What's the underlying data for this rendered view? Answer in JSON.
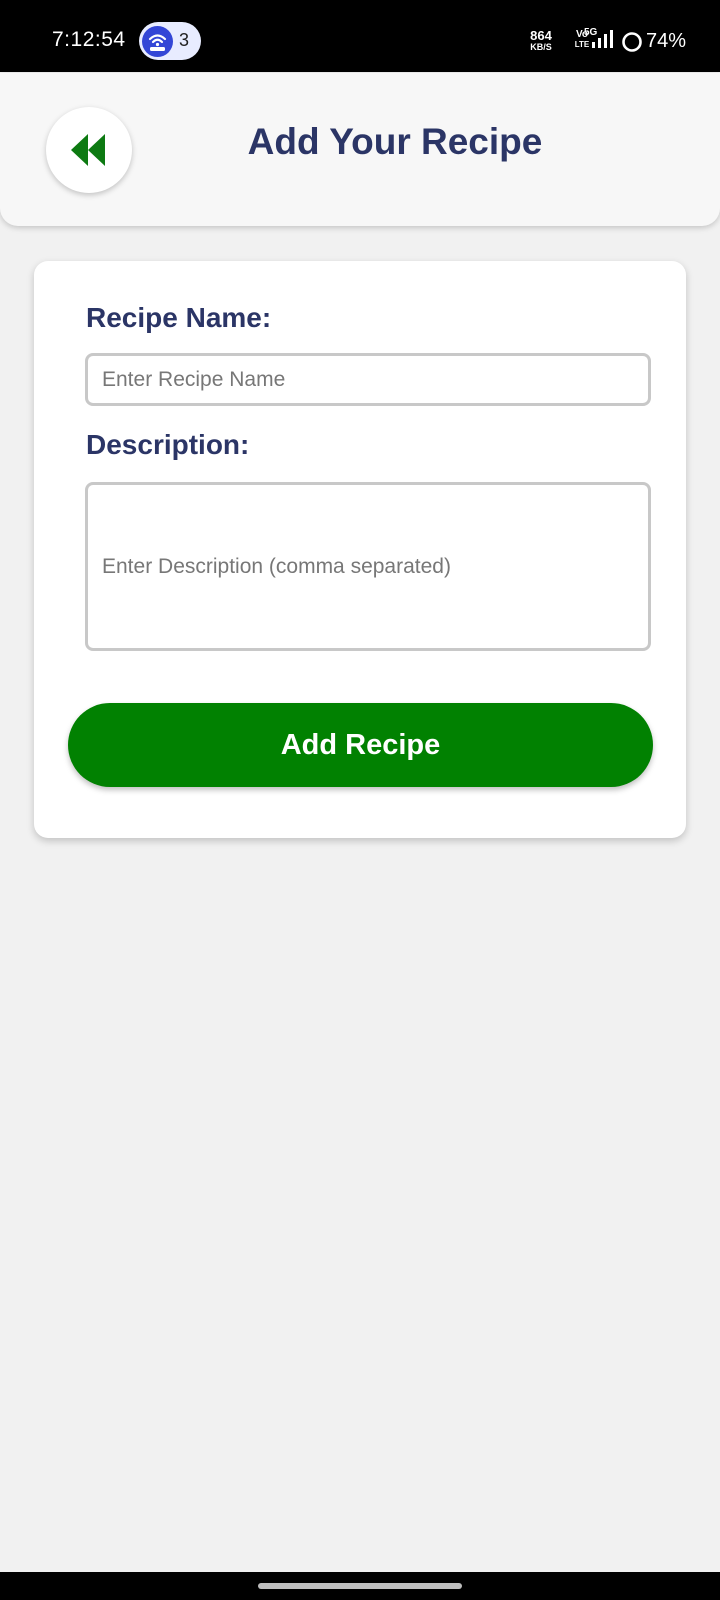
{
  "status_bar": {
    "time": "7:12:54",
    "hotspot_icon": "hotspot-icon",
    "hotspot_count": "3",
    "net_speed_value": "864",
    "net_speed_unit": "KB/S",
    "volte_top": "Vo",
    "volte_bottom": "LTE",
    "network_type": "5G",
    "battery": "74%",
    "battery_level_percent": 74
  },
  "header": {
    "title": "Add Your Recipe",
    "back_icon": "double-chevron-left-icon"
  },
  "form": {
    "recipe_name_label": "Recipe Name:",
    "recipe_name_placeholder": "Enter Recipe Name",
    "recipe_name_value": "",
    "description_label": "Description:",
    "description_placeholder": "Enter Description (comma separated)",
    "description_value": "",
    "submit_label": "Add Recipe"
  },
  "colors": {
    "accent_green": "#018101",
    "title_navy": "#2b3566",
    "background": "#f1f1f1"
  }
}
